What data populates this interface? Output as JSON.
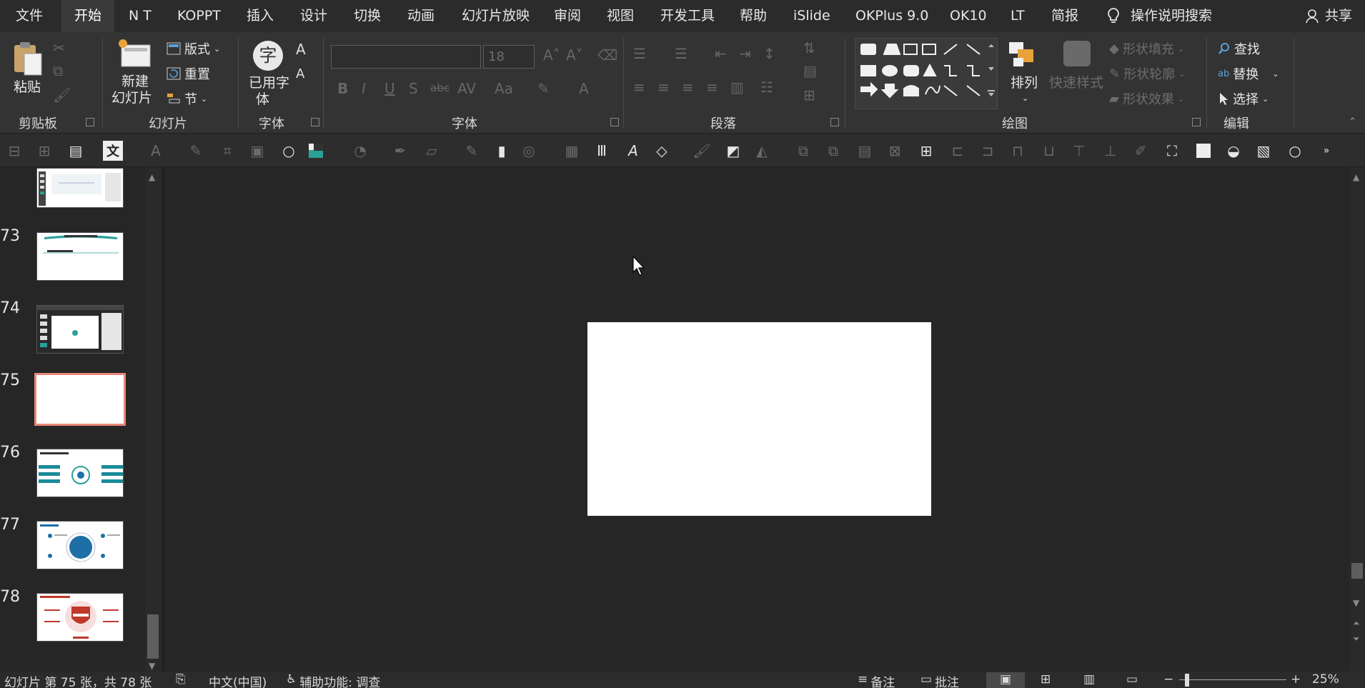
{
  "menu": {
    "tabs": [
      "文件",
      "开始",
      "N T",
      "KOPPT",
      "插入",
      "设计",
      "切换",
      "动画",
      "幻灯片放映",
      "审阅",
      "视图",
      "开发工具",
      "帮助",
      "iSlide",
      "OKPlus 9.0",
      "OK10",
      "LT",
      "简报"
    ],
    "active_tab": "开始",
    "search_label": "操作说明搜索",
    "share_label": "共享"
  },
  "ribbon": {
    "clipboard": {
      "paste": "粘贴",
      "label": "剪贴板"
    },
    "slides": {
      "new_slide_line1": "新建",
      "new_slide_line2": "幻灯片",
      "layout": "版式",
      "reset": "重置",
      "section": "节",
      "label": "幻灯片"
    },
    "used_font": {
      "glyph": "字",
      "line1": "已用字",
      "line2": "体",
      "label": "字体"
    },
    "font": {
      "font_name": "",
      "font_size": "18",
      "label": "字体"
    },
    "paragraph": {
      "label": "段落"
    },
    "drawing": {
      "arrange": "排列",
      "quick_styles": "快速样式",
      "shape_fill": "形状填充",
      "shape_outline": "形状轮廓",
      "shape_effects": "形状效果",
      "label": "绘图"
    },
    "editing": {
      "find": "查找",
      "replace": "替换",
      "select": "选择",
      "label": "编辑"
    }
  },
  "slides_panel": {
    "items": [
      {
        "num": "",
        "kind": "partial"
      },
      {
        "num": "73",
        "kind": "title"
      },
      {
        "num": "74",
        "kind": "dark"
      },
      {
        "num": "75",
        "kind": "blank",
        "selected": true
      },
      {
        "num": "76",
        "kind": "diagram"
      },
      {
        "num": "77",
        "kind": "circle"
      },
      {
        "num": "78",
        "kind": "red"
      }
    ]
  },
  "status": {
    "slide_info": "幻灯片 第 75 张，共 78 张",
    "language": "中文(中国)",
    "accessibility": "辅助功能: 调查",
    "notes": "备注",
    "comments": "批注",
    "zoom": "25%"
  },
  "colors": {
    "selected_thumb_border": "#e88878",
    "accent_teal": "#2aa198"
  }
}
